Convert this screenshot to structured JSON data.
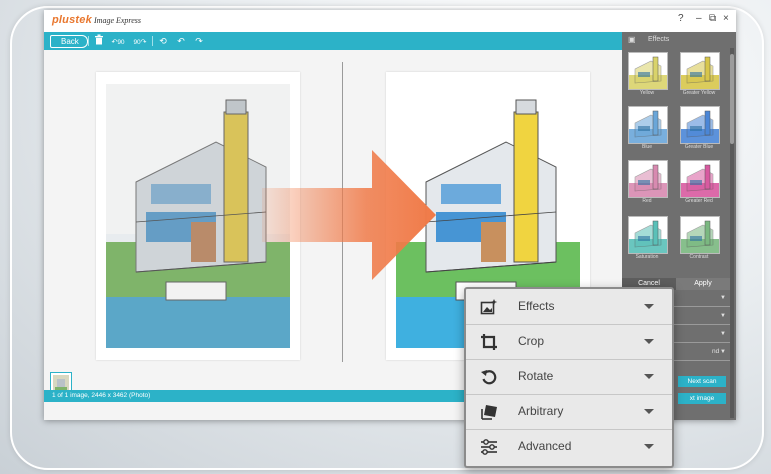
{
  "app": {
    "brand": "plustek",
    "name": "Image Express",
    "help": "?",
    "minimize": "–",
    "restore": "⧉",
    "close": "×"
  },
  "toolbar": {
    "back_label": "Back",
    "rotate_left_label": "90",
    "rotate_right_label": "90"
  },
  "status": {
    "text": "1 of 1 image, 2446 x 3462 (Photo)"
  },
  "effects_panel": {
    "title": "Effects",
    "items": [
      {
        "label": "Yellow",
        "tint": "#d9d36a"
      },
      {
        "label": "Greater Yellow",
        "tint": "#d7c64a"
      },
      {
        "label": "Blue",
        "tint": "#6aa6d9"
      },
      {
        "label": "Greater Blue",
        "tint": "#4a86d7"
      },
      {
        "label": "Red",
        "tint": "#d88ab0"
      },
      {
        "label": "Greater Red",
        "tint": "#d85aa0"
      },
      {
        "label": "Saturation",
        "tint": "#5ac0b8"
      },
      {
        "label": "Contrast",
        "tint": "#7ab880"
      }
    ],
    "cancel_label": "Cancel",
    "apply_label": "Apply",
    "row_partial_label": "nd",
    "next_scan_label": "Next scan",
    "next_image_label": "xt image"
  },
  "menu": {
    "items": [
      {
        "label": "Effects",
        "icon": "effects-icon"
      },
      {
        "label": "Crop",
        "icon": "crop-icon"
      },
      {
        "label": "Rotate",
        "icon": "rotate-icon"
      },
      {
        "label": "Arbitrary",
        "icon": "arbitrary-icon"
      },
      {
        "label": "Advanced",
        "icon": "advanced-icon"
      }
    ]
  },
  "colors": {
    "accent": "#2cb2c8",
    "brand": "#e9772e",
    "panel": "#6f6f6f",
    "arrow": "#f07a48"
  }
}
